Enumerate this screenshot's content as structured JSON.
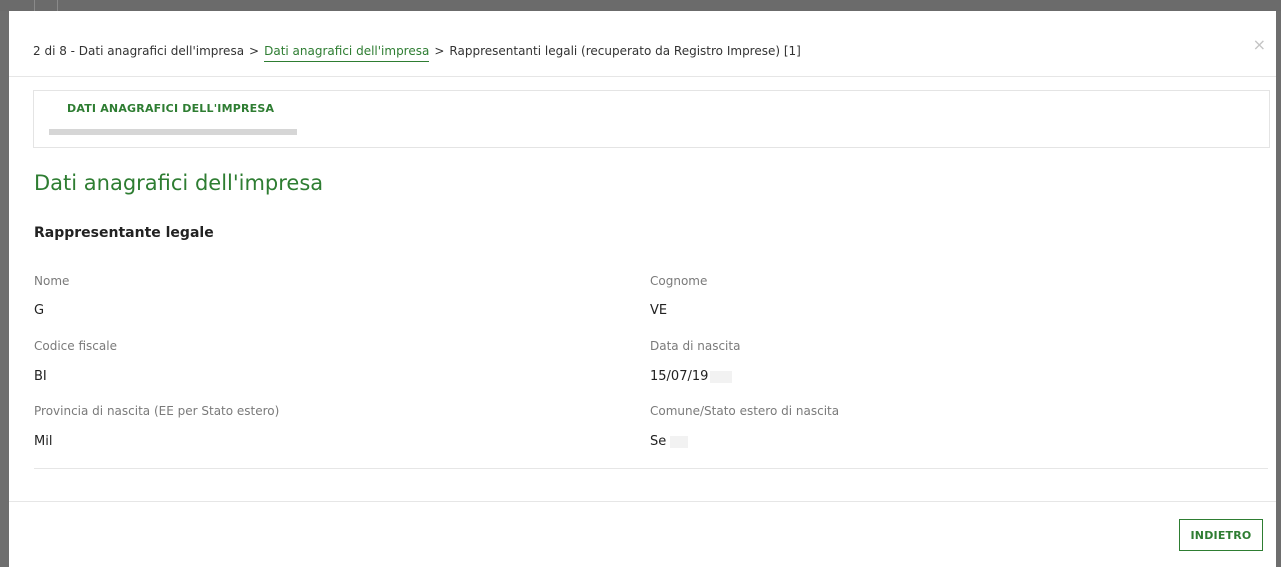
{
  "breadcrumb": {
    "step": "2 di 8 - Dati anagrafici dell'impresa",
    "link": "Dati anagrafici dell'impresa",
    "current": "Rappresentanti legali (recuperato da Registro Imprese) [1]",
    "separator": ">"
  },
  "close": "×",
  "tabs": [
    {
      "label": "DATI ANAGRAFICI DELL'IMPRESA"
    }
  ],
  "page_title": "Dati anagrafici dell'impresa",
  "section_title": "Rappresentante legale",
  "fields": {
    "nome": {
      "label": "Nome",
      "value": "G"
    },
    "cognome": {
      "label": "Cognome",
      "value": "VE"
    },
    "codice_fiscale": {
      "label": "Codice fiscale",
      "value": "BI"
    },
    "data_nascita": {
      "label": "Data di nascita",
      "value": "15/07/19"
    },
    "provincia": {
      "label": "Provincia di nascita (EE per Stato estero)",
      "value": "Mil"
    },
    "comune": {
      "label": "Comune/Stato estero di nascita",
      "value": "Se"
    }
  },
  "buttons": {
    "back": "INDIETRO"
  },
  "colors": {
    "accent": "#2e7d32",
    "backdrop": "#6b6b6b"
  }
}
